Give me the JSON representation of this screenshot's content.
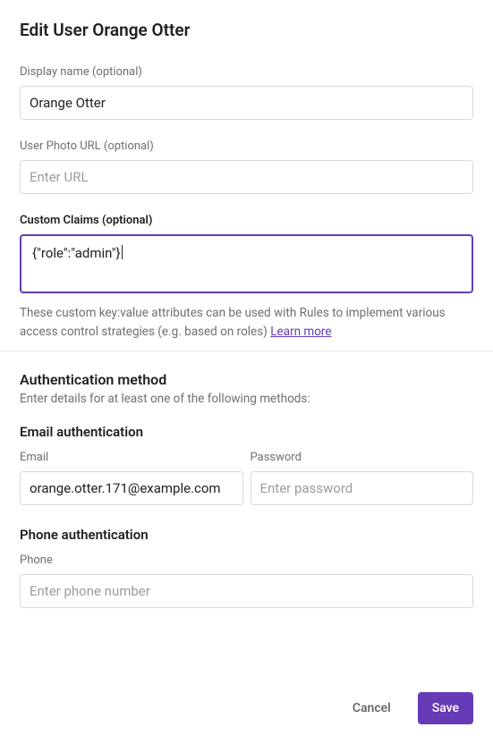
{
  "title": "Edit User Orange Otter",
  "fields": {
    "displayName": {
      "label": "Display name (optional)",
      "value": "Orange Otter"
    },
    "photoUrl": {
      "label": "User Photo URL (optional)",
      "placeholder": "Enter URL"
    },
    "customClaims": {
      "label": "Custom Claims (optional)",
      "value": "{\"role\":\"admin\"}"
    }
  },
  "claimsHelper": {
    "text": "These custom key:value attributes can be used with Rules to implement various access control strategies (e.g. based on roles) ",
    "link": "Learn more"
  },
  "auth": {
    "heading": "Authentication method",
    "sub": "Enter details for at least one of the following methods:",
    "email": {
      "heading": "Email authentication",
      "emailLabel": "Email",
      "emailValue": "orange.otter.171@example.com",
      "passwordLabel": "Password",
      "passwordPlaceholder": "Enter password"
    },
    "phone": {
      "heading": "Phone authentication",
      "label": "Phone",
      "placeholder": "Enter phone number"
    }
  },
  "footer": {
    "cancel": "Cancel",
    "save": "Save"
  }
}
